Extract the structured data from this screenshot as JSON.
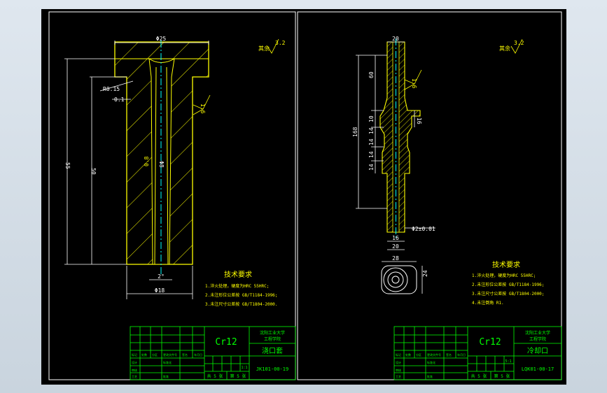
{
  "colors": {
    "background": "#000000",
    "frame": "#ffffff",
    "outline": "#ffff00",
    "hatch": "#ffff00",
    "dimension": "#ffffff",
    "centerline": "#00ffff",
    "title_block": "#00ff00",
    "roughness": "#ffff00",
    "viewport_bg": "#dfe7ef"
  },
  "left_sheet": {
    "dims": {
      "top_dia": "Φ25",
      "chamfer": "R0.15",
      "gap": "0.1",
      "height_total": "55",
      "height_inner": "50",
      "bottom_dia": "Φ18",
      "angle": "2°",
      "inner_dia": "Φ8"
    },
    "roughness": {
      "label": "其余",
      "value": "3.2"
    },
    "roughness_marks": [
      "1.6",
      "0.8"
    ],
    "tech": {
      "title": "技术要求",
      "lines": [
        "1.淬火处理，硬度为HRC 55HRC;",
        "2.未注形位公差按 GB/T1184-1996;",
        "3.未注尺寸公差按 GB/T1804-2000."
      ]
    },
    "title_block": {
      "material": "Cr12",
      "school_line1": "沈阳工业大学",
      "school_line2": "工程学院",
      "part_name": "浇口套",
      "drawing_no": "JK101-00-19",
      "scale": "1:1",
      "sheet_total": "共 5 张",
      "sheet_no": "第 5 张",
      "rows": [
        "标记",
        "处数",
        "分区",
        "更改文件号",
        "签名",
        "年月日"
      ],
      "roles": [
        "设计",
        "审核",
        "工艺",
        "标准化",
        "批准"
      ]
    }
  },
  "right_sheet": {
    "dims": {
      "top_w": "20",
      "h_60": "60",
      "h_168": "168",
      "h_10": "10",
      "h_16": "16",
      "h_14a": "14",
      "h_14b": "14",
      "h_14c": "14",
      "h_14d": "14",
      "hole_dia": "Φ2±0.01",
      "bottom_16": "16",
      "bottom_20": "20",
      "plan_w": "28",
      "plan_h": "24"
    },
    "roughness": {
      "label": "其余",
      "value": "3.2"
    },
    "roughness_marks": [
      "1.6"
    ],
    "tech": {
      "title": "技术要求",
      "lines": [
        "1.淬火处理，硬度为HRC 55HRC;",
        "2.未注形位公差按 GB/T1184-1996;",
        "3.未注尺寸公差按 GB/T1804-2000;",
        "4.未注倒角 R1."
      ]
    },
    "title_block": {
      "material": "Cr12",
      "school_line1": "沈阳工业大学",
      "school_line2": "工程学院",
      "part_name": "冷却口",
      "drawing_no": "LQK01-00-17",
      "scale": "5:1",
      "sheet_total": "共 5 张",
      "sheet_no": "第 5 张",
      "rows": [
        "标记",
        "处数",
        "分区",
        "更改文件号",
        "签名",
        "年月日"
      ],
      "roles": [
        "设计",
        "审核",
        "工艺",
        "标准化",
        "批准"
      ]
    }
  }
}
